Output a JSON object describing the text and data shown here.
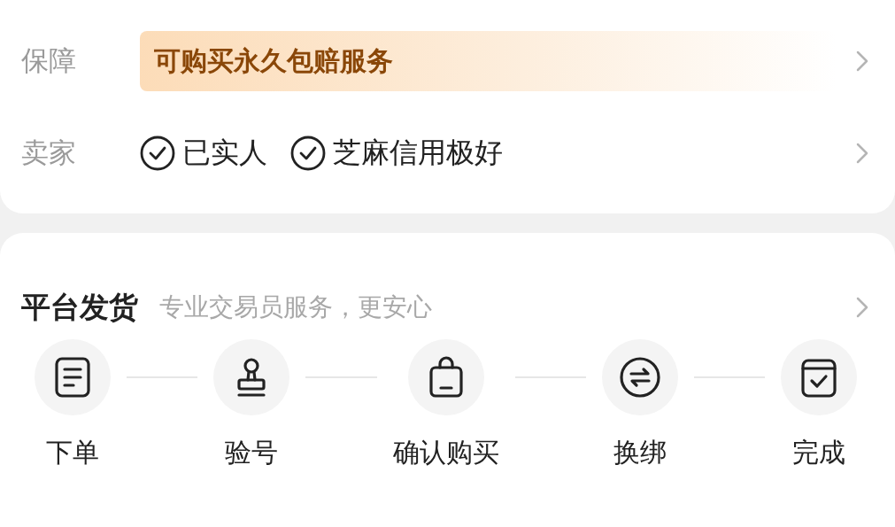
{
  "guarantee": {
    "label": "保障",
    "badge": "可购买永久包赔服务"
  },
  "seller": {
    "label": "卖家",
    "tags": [
      "已实人",
      "芝麻信用极好"
    ]
  },
  "delivery": {
    "title": "平台发货",
    "subtitle": "专业交易员服务，更安心",
    "steps": [
      {
        "kind": "document",
        "label": "下单"
      },
      {
        "kind": "stamp",
        "label": "验号"
      },
      {
        "kind": "bag",
        "label": "确认购买"
      },
      {
        "kind": "exchange",
        "label": "换绑"
      },
      {
        "kind": "calendar",
        "label": "完成"
      }
    ]
  }
}
